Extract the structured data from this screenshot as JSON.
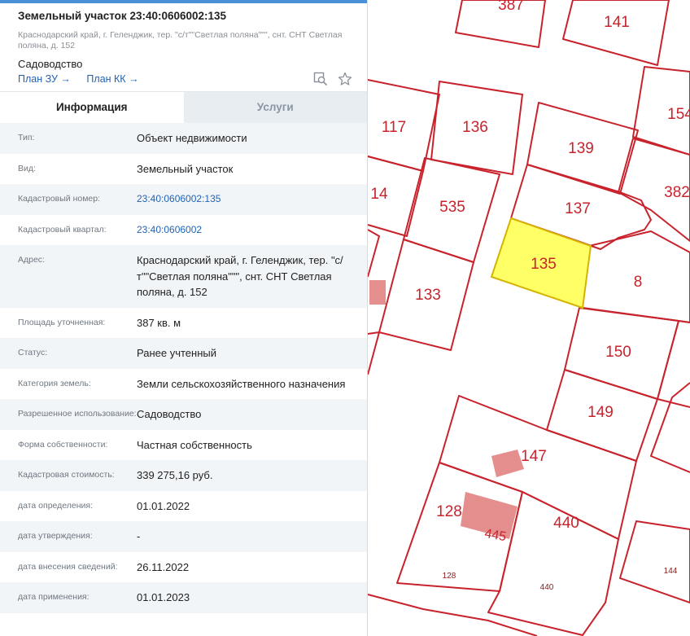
{
  "panel": {
    "title": "Земельный участок 23:40:0606002:135",
    "address_short": "Краснодарский край, г. Геленджик, тер. \"с/т\"\"Светлая поляна\"\"\", снт. СНТ Светлая поляна, д. 152",
    "purpose": "Садоводство",
    "links": {
      "plan_zu": "План ЗУ →",
      "plan_kk": "План КК →"
    },
    "icons": [
      "search-map-icon",
      "star-icon"
    ],
    "tabs": [
      {
        "label": "Информация",
        "active": true
      },
      {
        "label": "Услуги",
        "active": false
      }
    ],
    "rows": [
      {
        "label": "Тип:",
        "value": "Объект недвижимости"
      },
      {
        "label": "Вид:",
        "value": "Земельный участок"
      },
      {
        "label": "Кадастровый номер:",
        "value": "23:40:0606002:135",
        "link": true
      },
      {
        "label": "Кадастровый квартал:",
        "value": "23:40:0606002",
        "link": true
      },
      {
        "label": "Адрес:",
        "value": "Краснодарский край, г. Геленджик, тер. \"с/т\"\"Светлая поляна\"\"\", снт. СНТ Светлая поляна, д. 152"
      },
      {
        "label": "Площадь уточненная:",
        "value": "387 кв. м"
      },
      {
        "label": "Статус:",
        "value": "Ранее учтенный"
      },
      {
        "label": "Категория земель:",
        "value": "Земли сельскохозяйственного назначения"
      },
      {
        "label": "Разрешенное использование:",
        "value": "Садоводство"
      },
      {
        "label": "Форма собственности:",
        "value": "Частная собственность"
      },
      {
        "label": "Кадастровая стоимость:",
        "value": "339 275,16 руб."
      },
      {
        "label": "дата определения:",
        "value": "01.01.2022"
      },
      {
        "label": "дата утверждения:",
        "value": "-"
      },
      {
        "label": "дата внесения сведений:",
        "value": "26.11.2022"
      },
      {
        "label": "дата применения:",
        "value": "01.01.2023"
      }
    ]
  },
  "map": {
    "colors": {
      "boundary": "#c8232c",
      "selected_fill": "#ffff66",
      "selected_stroke": "#d4b400",
      "building": "#e07a7a",
      "label": "#c8232c"
    },
    "parcel_labels": [
      "387",
      "141",
      "154",
      "117",
      "136",
      "139",
      "14",
      "535",
      "137",
      "382",
      "135",
      "8",
      "133",
      "150",
      "149",
      "147",
      "128",
      "445",
      "440"
    ],
    "small_labels": [
      "128",
      "440",
      "144"
    ]
  }
}
